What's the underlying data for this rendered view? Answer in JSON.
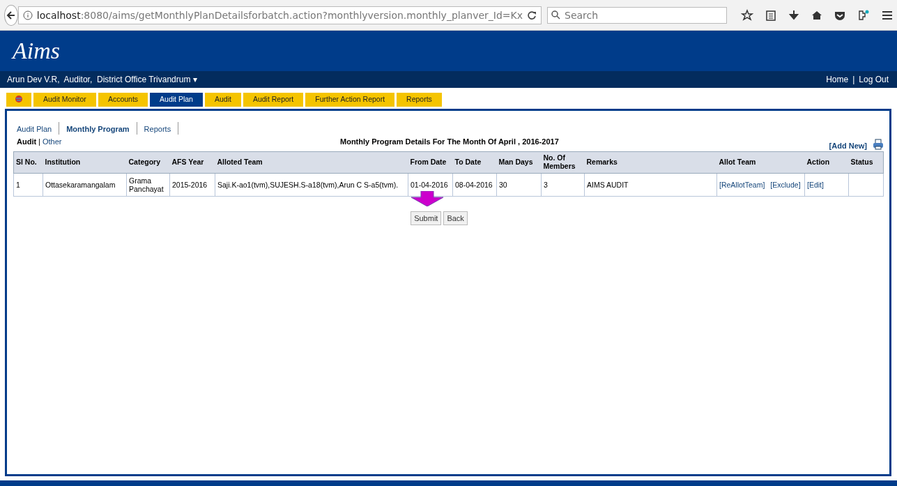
{
  "browser": {
    "url_host": "localhost",
    "url_rest": ":8080/aims/getMonthlyPlanDetailsforbatch.action?monthlyversion.monthly_planver_Id=Kx",
    "search_placeholder": "Search"
  },
  "logo": "Aims",
  "user_bar": {
    "user": "Arun Dev V.R,  Auditor,  District Office Trivandrum ▾",
    "links": [
      "Home",
      "Log Out"
    ],
    "separator": "|"
  },
  "tabs": [
    {
      "label": "Audit Monitor",
      "selected": false
    },
    {
      "label": "Accounts",
      "selected": false
    },
    {
      "label": "Audit Plan",
      "selected": true
    },
    {
      "label": "Audit",
      "selected": false
    },
    {
      "label": "Audit Report",
      "selected": false
    },
    {
      "label": "Further Action Report",
      "selected": false
    },
    {
      "label": "Reports",
      "selected": false
    }
  ],
  "sub_tabs": [
    {
      "label": "Audit Plan",
      "selected": false
    },
    {
      "label": "Monthly Program",
      "selected": true
    },
    {
      "label": "Reports",
      "selected": false
    }
  ],
  "filter": [
    {
      "label": "Audit",
      "selected": true
    },
    {
      "label": "Other",
      "selected": false
    }
  ],
  "filter_separator": "|",
  "heading": "Monthly Program Details For The Month Of April , 2016-2017",
  "add_new": "[Add New]",
  "table": {
    "columns": [
      "Sl No.",
      "Institution",
      "Category",
      "AFS Year",
      "Alloted Team",
      "From Date",
      "To Date",
      "Man Days",
      "No. Of Members",
      "Remarks",
      "Allot Team",
      "Action",
      "Status"
    ],
    "rows": [
      {
        "cells": [
          "1",
          "Ottasekaramangalam",
          "Grama Panchayat",
          "2015-2016",
          "Saji.K-ao1(tvm),SUJESH.S-a18(tvm),Arun C S-a5(tvm).",
          "01-04-2016",
          "08-04-2016",
          "30",
          "3",
          "AIMS AUDIT"
        ],
        "allot_links": [
          "[ReAllotTeam]",
          "[Exclude]"
        ],
        "action_links": [
          "[Edit]"
        ]
      }
    ]
  },
  "buttons": [
    "Submit",
    "Back"
  ]
}
